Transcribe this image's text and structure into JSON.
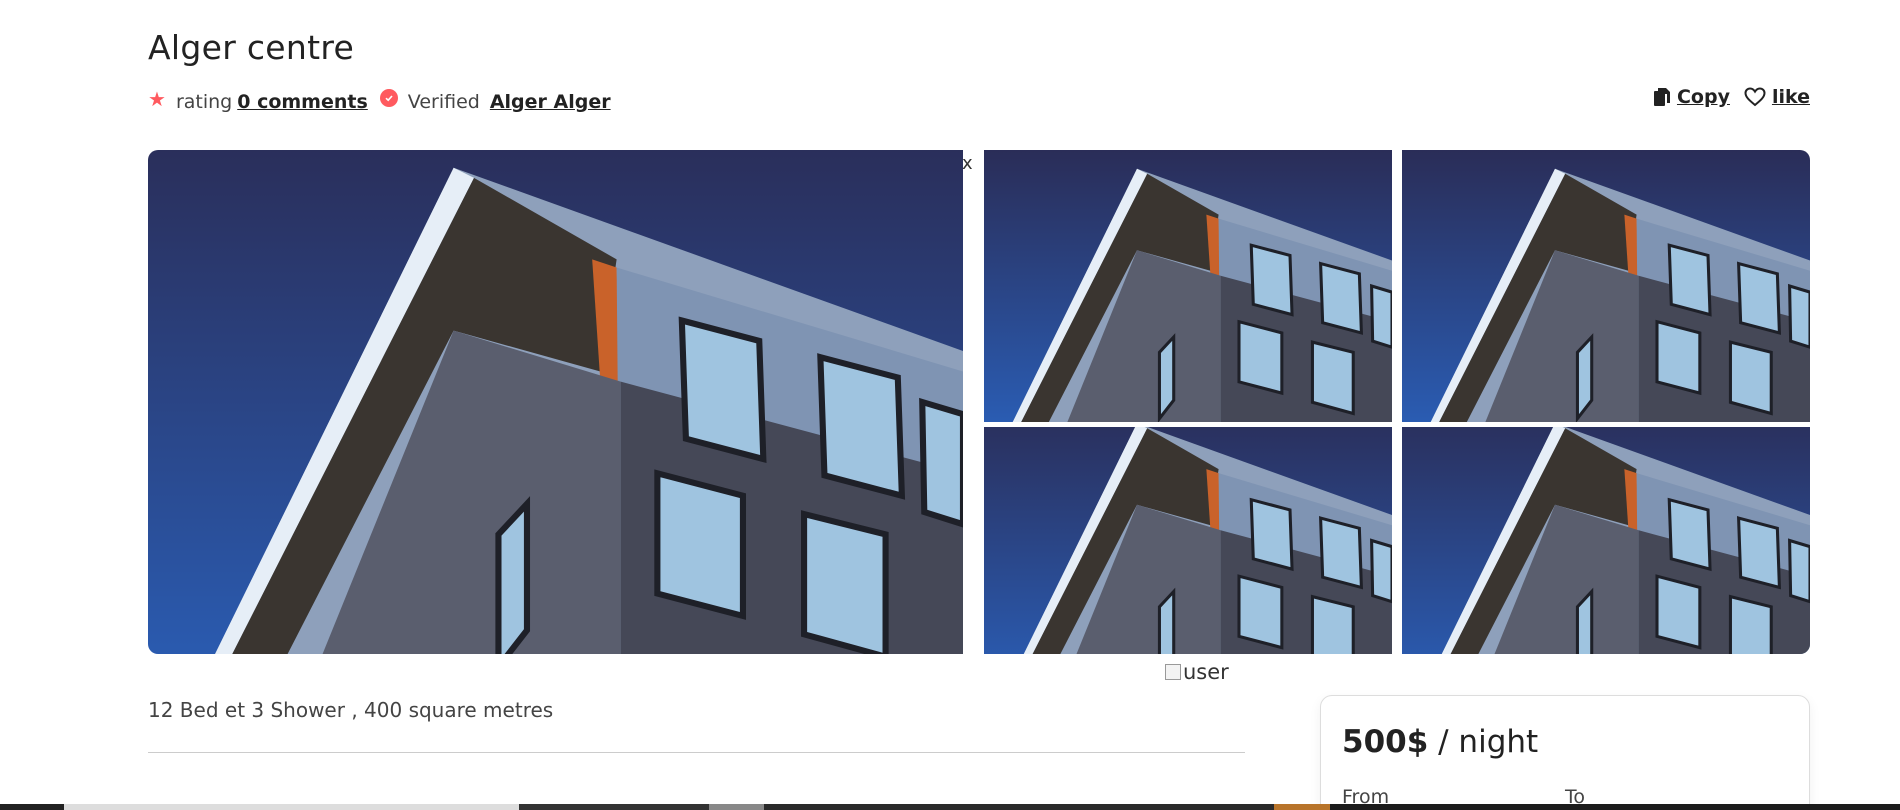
{
  "listing": {
    "title": "Alger centre",
    "rating_label": "rating",
    "comments_link": "0 comments",
    "verified_label": "Verified",
    "host_link": "Alger Alger"
  },
  "actions": {
    "copy_label": "Copy",
    "like_label": "like"
  },
  "gallery": {
    "close_label": "x",
    "broken_image_alt": "user",
    "photos": [
      "building-photo",
      "building-photo",
      "building-photo",
      "building-photo",
      "building-photo"
    ]
  },
  "details": {
    "summary": "12 Bed et 3 Shower , 400 square metres"
  },
  "booking": {
    "price": "500$",
    "per": " / night",
    "from_label": "From",
    "to_label": "To"
  },
  "colors": {
    "accent": "#ff5a5f",
    "sky_top": "#2a2a52",
    "sky_bottom": "#2a5fb8",
    "text": "#222222"
  }
}
